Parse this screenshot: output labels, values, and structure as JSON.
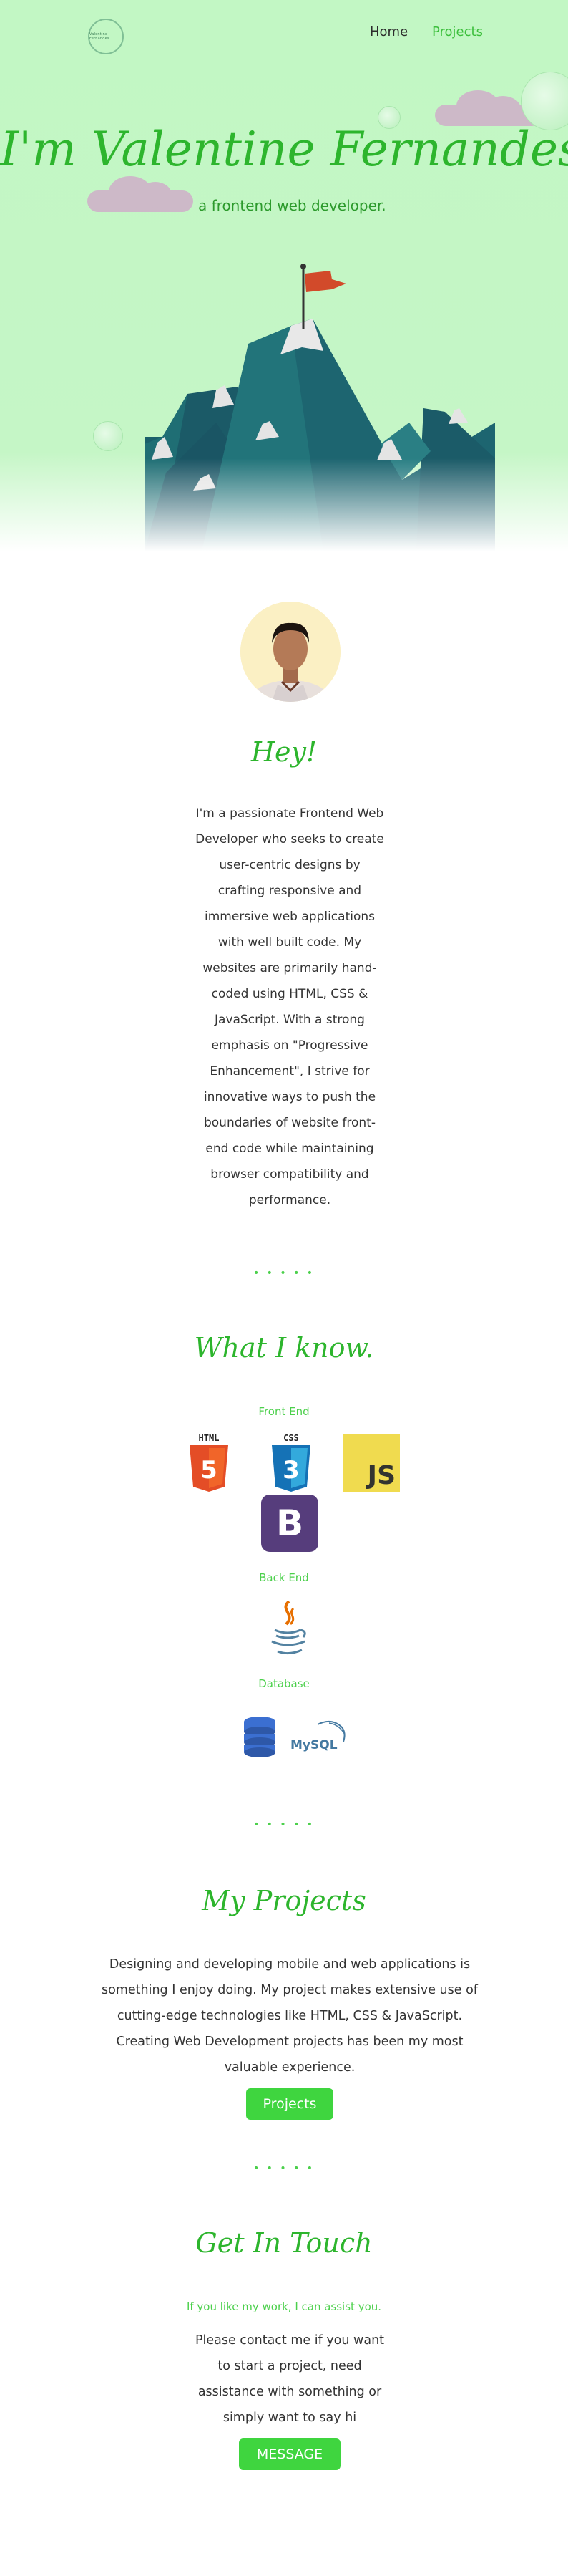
{
  "brand": {
    "logo_text": "Valentine Fernandes"
  },
  "nav": {
    "home": "Home",
    "projects": "Projects"
  },
  "hero": {
    "title": "I'm Valentine Fernandes",
    "subtitle": "a frontend web developer."
  },
  "about": {
    "heading": "Hey!",
    "lines": [
      "I'm a passionate Frontend Web",
      "Developer who seeks to create",
      "user-centric designs by",
      "crafting responsive and",
      "immersive web applications",
      "with well built code. My",
      "websites are primarily hand-",
      "coded using HTML, CSS &",
      "JavaScript. With a strong",
      "emphasis on \"Progressive",
      "Enhancement\", I strive for",
      "innovative ways to push the",
      "boundaries of website front-",
      "end code while maintaining",
      "browser compatibility and",
      "performance."
    ]
  },
  "divider": "• • • • •",
  "skills": {
    "heading": "What I know.",
    "frontend_label": "Front End",
    "backend_label": "Back End",
    "database_label": "Database",
    "html_label": "HTML",
    "css_label": "CSS",
    "js_label": "JS",
    "bootstrap_label": "B",
    "mysql_label": "MySQL"
  },
  "projects": {
    "heading": "My Projects",
    "lines": [
      "Designing and developing mobile and web applications is",
      "something I enjoy doing. My project makes extensive use of",
      "cutting-edge technologies like HTML, CSS & JavaScript.",
      "Creating Web Development projects has been my most",
      "valuable experience."
    ],
    "button": "Projects"
  },
  "contact": {
    "heading": "Get In Touch",
    "tagline": "If you like my work, I can assist you.",
    "lines": [
      "Please contact me if you want",
      "to start a project, need",
      "assistance with something or",
      "simply want to say hi"
    ],
    "button": "MESSAGE"
  }
}
